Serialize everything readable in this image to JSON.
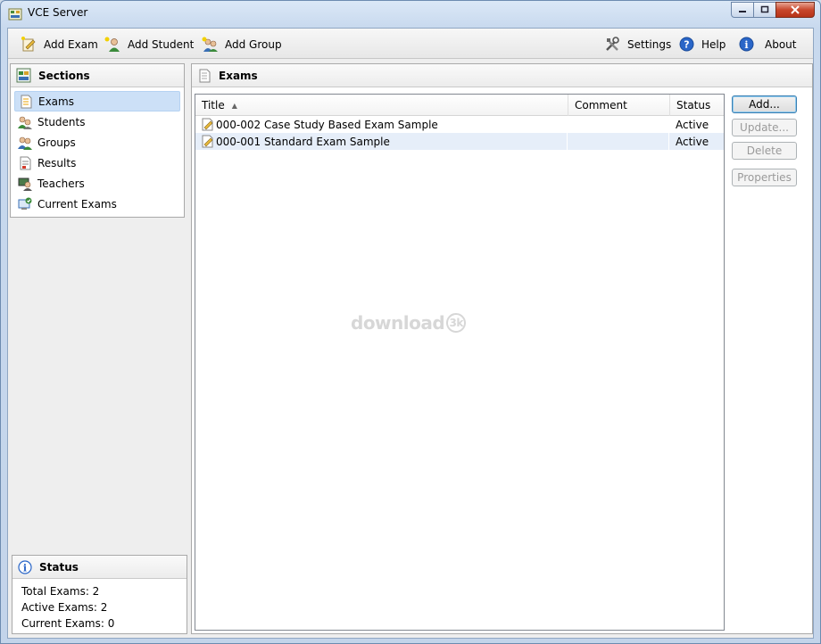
{
  "window": {
    "title": "VCE Server"
  },
  "toolbar": {
    "add_exam": "Add Exam",
    "add_student": "Add Student",
    "add_group": "Add Group",
    "settings": "Settings",
    "help": "Help",
    "about": "About"
  },
  "sections": {
    "header": "Sections",
    "items": [
      {
        "label": "Exams",
        "icon": "exam-icon",
        "selected": true
      },
      {
        "label": "Students",
        "icon": "students-icon"
      },
      {
        "label": "Groups",
        "icon": "groups-icon"
      },
      {
        "label": "Results",
        "icon": "results-icon"
      },
      {
        "label": "Teachers",
        "icon": "teachers-icon"
      },
      {
        "label": "Current Exams",
        "icon": "current-exams-icon"
      }
    ]
  },
  "status": {
    "header": "Status",
    "total": "Total Exams: 2",
    "active": "Active Exams: 2",
    "current": "Current Exams: 0"
  },
  "main": {
    "header": "Exams",
    "columns": {
      "title": "Title",
      "comment": "Comment",
      "status": "Status"
    },
    "rows": [
      {
        "title": "000-002 Case Study Based Exam Sample",
        "comment": "",
        "status": "Active"
      },
      {
        "title": "000-001 Standard Exam Sample",
        "comment": "",
        "status": "Active"
      }
    ],
    "watermark": "download",
    "watermark_badge": "3k"
  },
  "buttons": {
    "add": "Add...",
    "update": "Update...",
    "delete": "Delete",
    "properties": "Properties"
  },
  "colors": {
    "selection": "#cce0f7",
    "alt_row": "#e6eef9",
    "close_button": "#c8472c"
  }
}
